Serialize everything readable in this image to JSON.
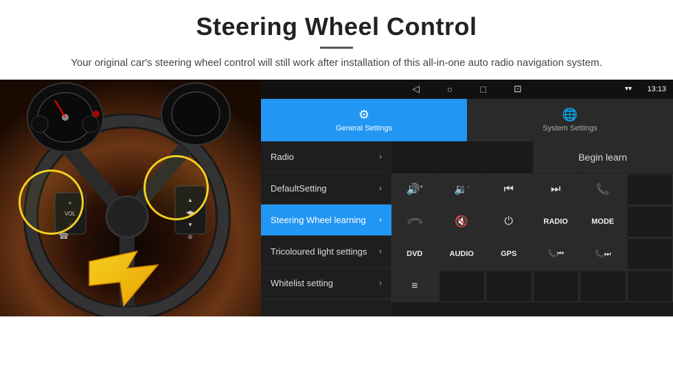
{
  "page": {
    "title": "Steering Wheel Control",
    "divider": true,
    "subtitle": "Your original car's steering wheel control will still work after installation of this all-in-one auto radio navigation system."
  },
  "status_bar": {
    "time": "13:13",
    "signal_icon": "▾",
    "wifi_icon": "▾"
  },
  "nav_bar": {
    "back": "◁",
    "home": "○",
    "recent": "□",
    "cast": "⊡"
  },
  "tabs": [
    {
      "id": "general",
      "label": "General Settings",
      "icon": "⚙",
      "active": true
    },
    {
      "id": "system",
      "label": "System Settings",
      "icon": "🌐",
      "active": false
    }
  ],
  "menu": {
    "items": [
      {
        "id": "radio",
        "label": "Radio",
        "active": false
      },
      {
        "id": "default",
        "label": "DefaultSetting",
        "active": false
      },
      {
        "id": "steering",
        "label": "Steering Wheel learning",
        "active": true
      },
      {
        "id": "tricoloured",
        "label": "Tricoloured light settings",
        "active": false
      },
      {
        "id": "whitelist",
        "label": "Whitelist setting",
        "active": false
      }
    ]
  },
  "controls": {
    "begin_learn": "Begin learn",
    "buttons": [
      {
        "id": "vol-up",
        "icon": "🔊+",
        "label": "Vol Up"
      },
      {
        "id": "vol-down",
        "icon": "🔉-",
        "label": "Vol Down"
      },
      {
        "id": "prev",
        "icon": "⏮",
        "label": "Prev"
      },
      {
        "id": "next",
        "icon": "⏭",
        "label": "Next"
      },
      {
        "id": "phone",
        "icon": "📞",
        "label": "Phone"
      },
      {
        "id": "hang-up",
        "icon": "↩",
        "label": "Hang Up"
      },
      {
        "id": "mute",
        "icon": "🔇",
        "label": "Mute"
      },
      {
        "id": "power",
        "icon": "⏻",
        "label": "Power"
      },
      {
        "id": "radio-btn",
        "icon": "RADIO",
        "label": "Radio",
        "text": true
      },
      {
        "id": "mode",
        "icon": "MODE",
        "label": "Mode",
        "text": true
      },
      {
        "id": "dvd",
        "icon": "DVD",
        "label": "DVD",
        "text": true
      },
      {
        "id": "audio",
        "icon": "AUDIO",
        "label": "Audio",
        "text": true
      },
      {
        "id": "gps",
        "icon": "GPS",
        "label": "GPS",
        "text": true
      },
      {
        "id": "tel-prev",
        "icon": "📞⏮",
        "label": "Tel Prev"
      },
      {
        "id": "tel-next",
        "icon": "📞⏭",
        "label": "Tel Next"
      },
      {
        "id": "source",
        "icon": "≡",
        "label": "Source"
      }
    ]
  }
}
